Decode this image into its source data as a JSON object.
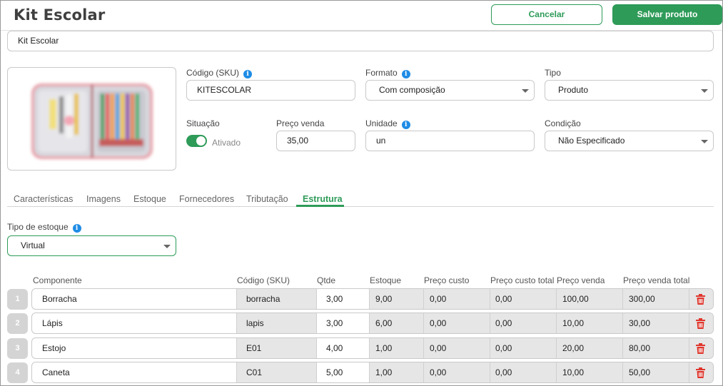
{
  "header": {
    "title": "Kit Escolar",
    "cancel_label": "Cancelar",
    "save_label": "Salvar produto"
  },
  "product_name": {
    "value": "Kit Escolar"
  },
  "fields": {
    "sku": {
      "label": "Código (SKU)",
      "value": "KITESCOLAR"
    },
    "formato": {
      "label": "Formato",
      "value": "Com composição"
    },
    "tipo": {
      "label": "Tipo",
      "value": "Produto"
    },
    "situacao": {
      "label": "Situação",
      "value": "Ativado",
      "enabled": true
    },
    "preco_venda": {
      "label": "Preço venda",
      "value": "35,00"
    },
    "unidade": {
      "label": "Unidade",
      "value": "un"
    },
    "condicao": {
      "label": "Condição",
      "value": "Não Especificado"
    }
  },
  "tabs": [
    {
      "label": "Características"
    },
    {
      "label": "Imagens"
    },
    {
      "label": "Estoque"
    },
    {
      "label": "Fornecedores"
    },
    {
      "label": "Tributação"
    },
    {
      "label": "Estrutura",
      "active": true
    }
  ],
  "tipo_estoque": {
    "label": "Tipo de estoque",
    "value": "Virtual"
  },
  "table": {
    "headers": [
      "Componente",
      "Código (SKU)",
      "Qtde",
      "Estoque",
      "Preço custo",
      "Preço custo total",
      "Preço venda",
      "Preço venda total"
    ],
    "rows": [
      {
        "num": "1",
        "componente": "Borracha",
        "sku": "borracha",
        "qtde": "3,00",
        "estoque": "9,00",
        "preco_custo": "0,00",
        "preco_custo_total": "0,00",
        "preco_venda": "100,00",
        "preco_venda_total": "300,00"
      },
      {
        "num": "2",
        "componente": "Lápis",
        "sku": "lapis",
        "qtde": "3,00",
        "estoque": "6,00",
        "preco_custo": "0,00",
        "preco_custo_total": "0,00",
        "preco_venda": "10,00",
        "preco_venda_total": "30,00"
      },
      {
        "num": "3",
        "componente": "Estojo",
        "sku": "E01",
        "qtde": "4,00",
        "estoque": "1,00",
        "preco_custo": "0,00",
        "preco_custo_total": "0,00",
        "preco_venda": "20,00",
        "preco_venda_total": "80,00"
      },
      {
        "num": "4",
        "componente": "Caneta",
        "sku": "C01",
        "qtde": "5,00",
        "estoque": "1,00",
        "preco_custo": "0,00",
        "preco_custo_total": "0,00",
        "preco_venda": "10,00",
        "preco_venda_total": "50,00"
      }
    ]
  },
  "icons": {
    "info": "info-icon",
    "caret": "chevron-down-icon",
    "delete": "trash-icon"
  },
  "colors": {
    "accent": "#2e9b58",
    "info": "#1f8ce6",
    "delete": "#e0362c"
  }
}
